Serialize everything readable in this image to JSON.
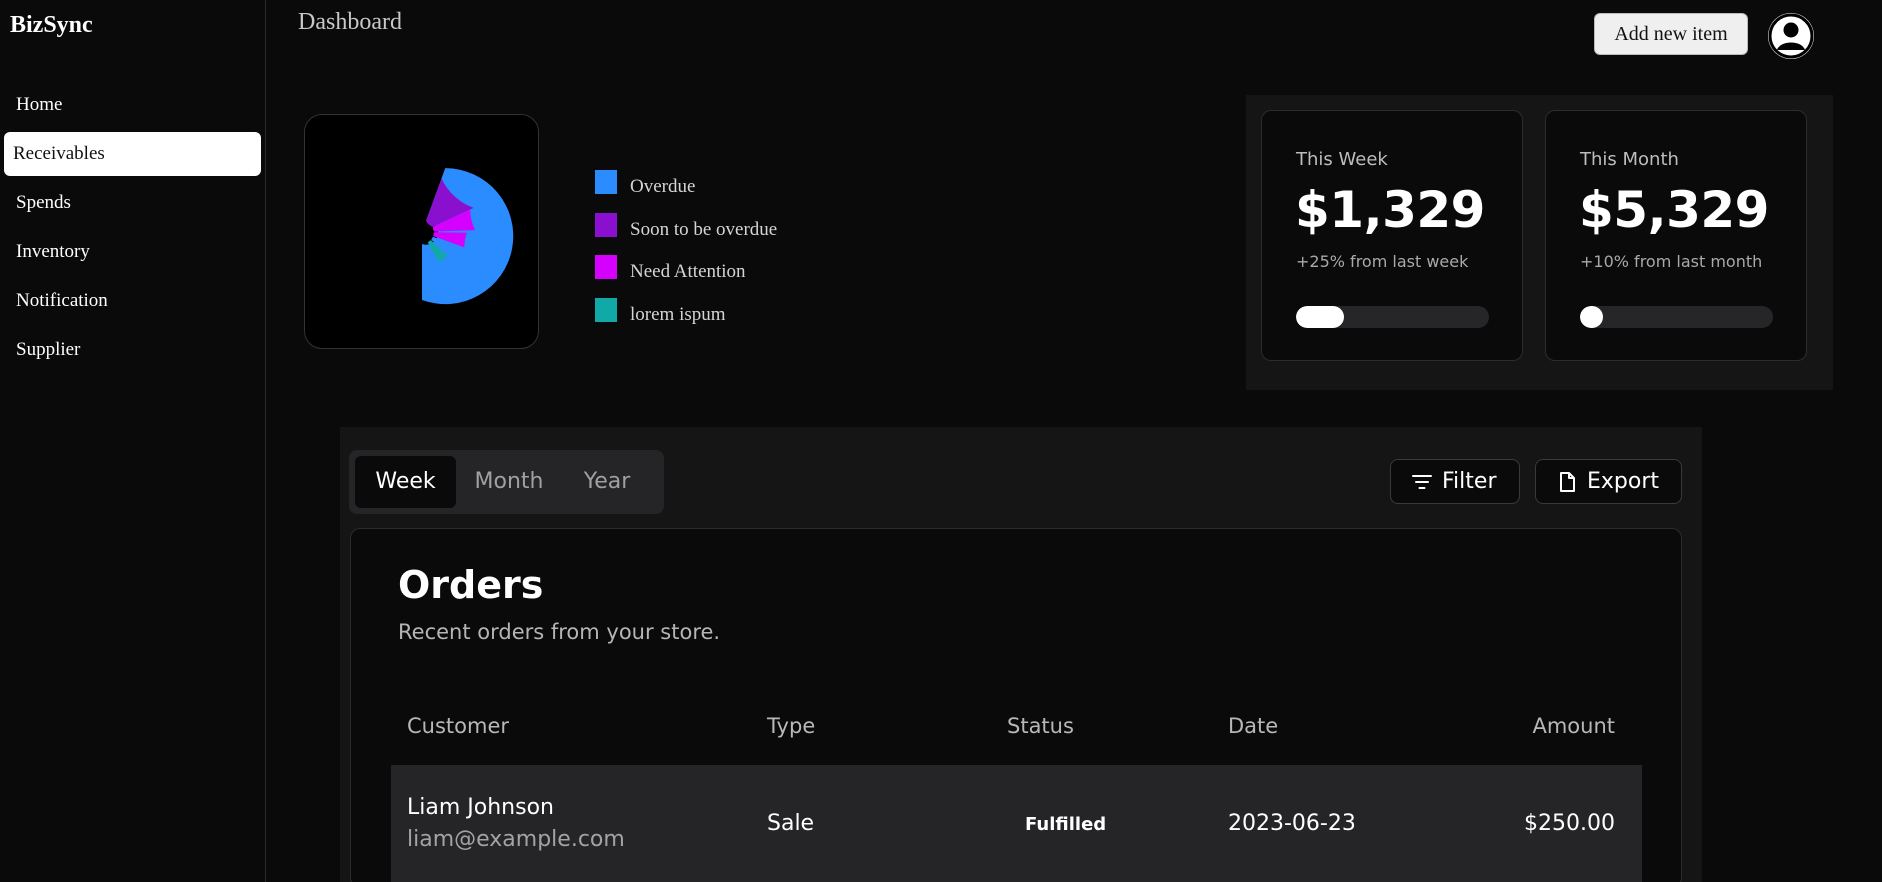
{
  "app": {
    "brand": "BizSync"
  },
  "sidebar": {
    "items": [
      {
        "label": "Home",
        "active": false
      },
      {
        "label": "Receivables",
        "active": true
      },
      {
        "label": "Spends",
        "active": false
      },
      {
        "label": "Inventory",
        "active": false
      },
      {
        "label": "Notification",
        "active": false
      },
      {
        "label": "Supplier",
        "active": false
      }
    ]
  },
  "header": {
    "title": "Dashboard",
    "add_button": "Add new item",
    "avatar_icon": "user-icon"
  },
  "donut": {
    "legend": [
      {
        "label": "Overdue",
        "color": "#2b8cff"
      },
      {
        "label": "Soon to be overdue",
        "color": "#8a0fcf"
      },
      {
        "label": "Need Attention",
        "color": "#d600ff"
      },
      {
        "label": "lorem ispum",
        "color": "#11a8a8"
      }
    ]
  },
  "stats": [
    {
      "label": "This Week",
      "value": "$1,329",
      "change": "+25% from last week",
      "progress": 0.25
    },
    {
      "label": "This Month",
      "value": "$5,329",
      "change": "+10% from last month",
      "progress": 0.12
    }
  ],
  "orders": {
    "tabs": [
      {
        "label": "Week",
        "active": true
      },
      {
        "label": "Month",
        "active": false
      },
      {
        "label": "Year",
        "active": false
      }
    ],
    "filter_label": "Filter",
    "filter_icon": "filter-icon",
    "export_label": "Export",
    "export_icon": "file-icon",
    "title": "Orders",
    "subtitle": "Recent orders from your store.",
    "columns": [
      "Customer",
      "Type",
      "Status",
      "Date",
      "Amount"
    ],
    "rows": [
      {
        "name": "Liam Johnson",
        "email": "liam@example.com",
        "type": "Sale",
        "status": "Fulfilled",
        "date": "2023-06-23",
        "amount": "$250.00"
      }
    ]
  }
}
